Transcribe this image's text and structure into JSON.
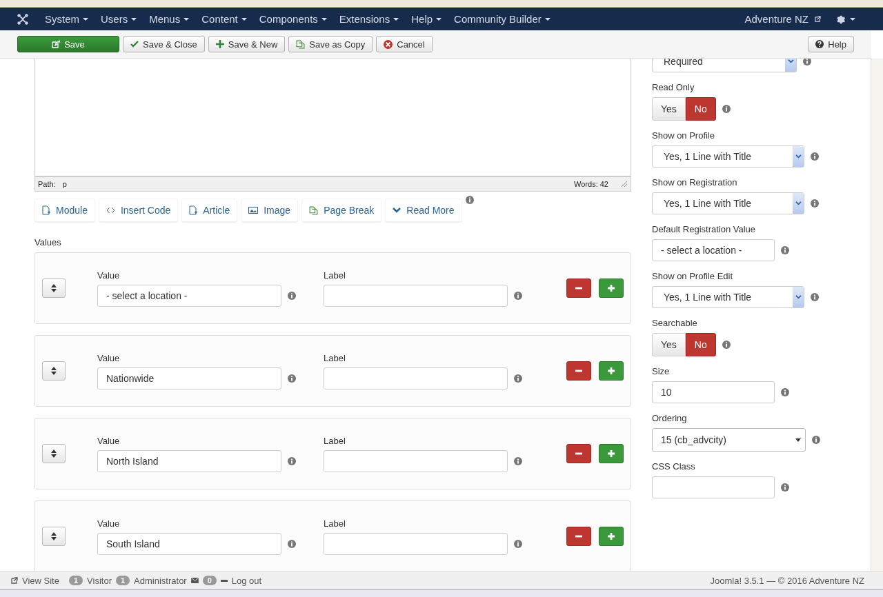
{
  "nav": {
    "menus": [
      {
        "text": "System"
      },
      {
        "text": "Users"
      },
      {
        "text": "Menus"
      },
      {
        "text": "Content"
      },
      {
        "text": "Components"
      },
      {
        "text": "Extensions"
      },
      {
        "text": "Help"
      },
      {
        "text": "Community Builder"
      }
    ],
    "site": "Adventure NZ"
  },
  "toolbar": {
    "buttons": [
      {
        "kind": "save",
        "text": "Save"
      },
      {
        "kind": "check",
        "text": "Save & Close"
      },
      {
        "kind": "plus",
        "text": "Save & New"
      },
      {
        "kind": "copy",
        "text": "Save as Copy"
      },
      {
        "kind": "cancel",
        "text": "Cancel"
      }
    ],
    "help": "Help"
  },
  "editor": {
    "path_label": "Path:",
    "path": "p",
    "words": "Words: 42"
  },
  "editor_buttons": [
    {
      "kind": "doc",
      "text": "Module"
    },
    {
      "kind": "code",
      "text": "Insert Code"
    },
    {
      "kind": "doc",
      "text": "Article"
    },
    {
      "kind": "image",
      "text": "Image"
    },
    {
      "kind": "copy",
      "text": "Page Break"
    },
    {
      "kind": "chevron",
      "text": "Read More"
    }
  ],
  "values": {
    "title": "Values",
    "rows": [
      {
        "value_label": "Value",
        "value": "- select a location -",
        "label_label": "Label"
      },
      {
        "value_label": "Value",
        "value": "Nationwide",
        "label_label": "Label"
      },
      {
        "value_label": "Value",
        "value": "North Island",
        "label_label": "Label"
      },
      {
        "value_label": "Value",
        "value": "South Island",
        "label_label": "Label"
      }
    ]
  },
  "settings": [
    {
      "kind": "select",
      "value": "Required"
    },
    {
      "kind": "toggle",
      "label": "Read Only",
      "options": [
        {
          "text": "Yes",
          "selected": false
        },
        {
          "text": "No",
          "selected": true
        }
      ]
    },
    {
      "kind": "select",
      "label": "Show on Profile",
      "value": "Yes, 1 Line with Title"
    },
    {
      "kind": "select",
      "label": "Show on Registration",
      "value": "Yes, 1 Line with Title"
    },
    {
      "kind": "input",
      "label": "Default Registration Value",
      "value": "- select a location -"
    },
    {
      "kind": "select",
      "label": "Show on Profile Edit",
      "value": "Yes, 1 Line with Title"
    },
    {
      "kind": "toggle",
      "label": "Searchable",
      "options": [
        {
          "text": "Yes",
          "selected": false
        },
        {
          "text": "No",
          "selected": true
        }
      ]
    },
    {
      "kind": "input",
      "label": "Size",
      "value": "10"
    },
    {
      "kind": "dropdown",
      "label": "Ordering",
      "value": "15 (cb_advcity)"
    },
    {
      "kind": "input",
      "label": "CSS Class"
    }
  ],
  "status": {
    "view_site": "View Site",
    "visitors": "1",
    "visitor_label": "Visitor",
    "admins": "1",
    "admin_label": "Administrator",
    "messages": "0",
    "logout": "Log out",
    "footer": "Joomla! 3.5.1 — © 2016 Adventure NZ"
  }
}
